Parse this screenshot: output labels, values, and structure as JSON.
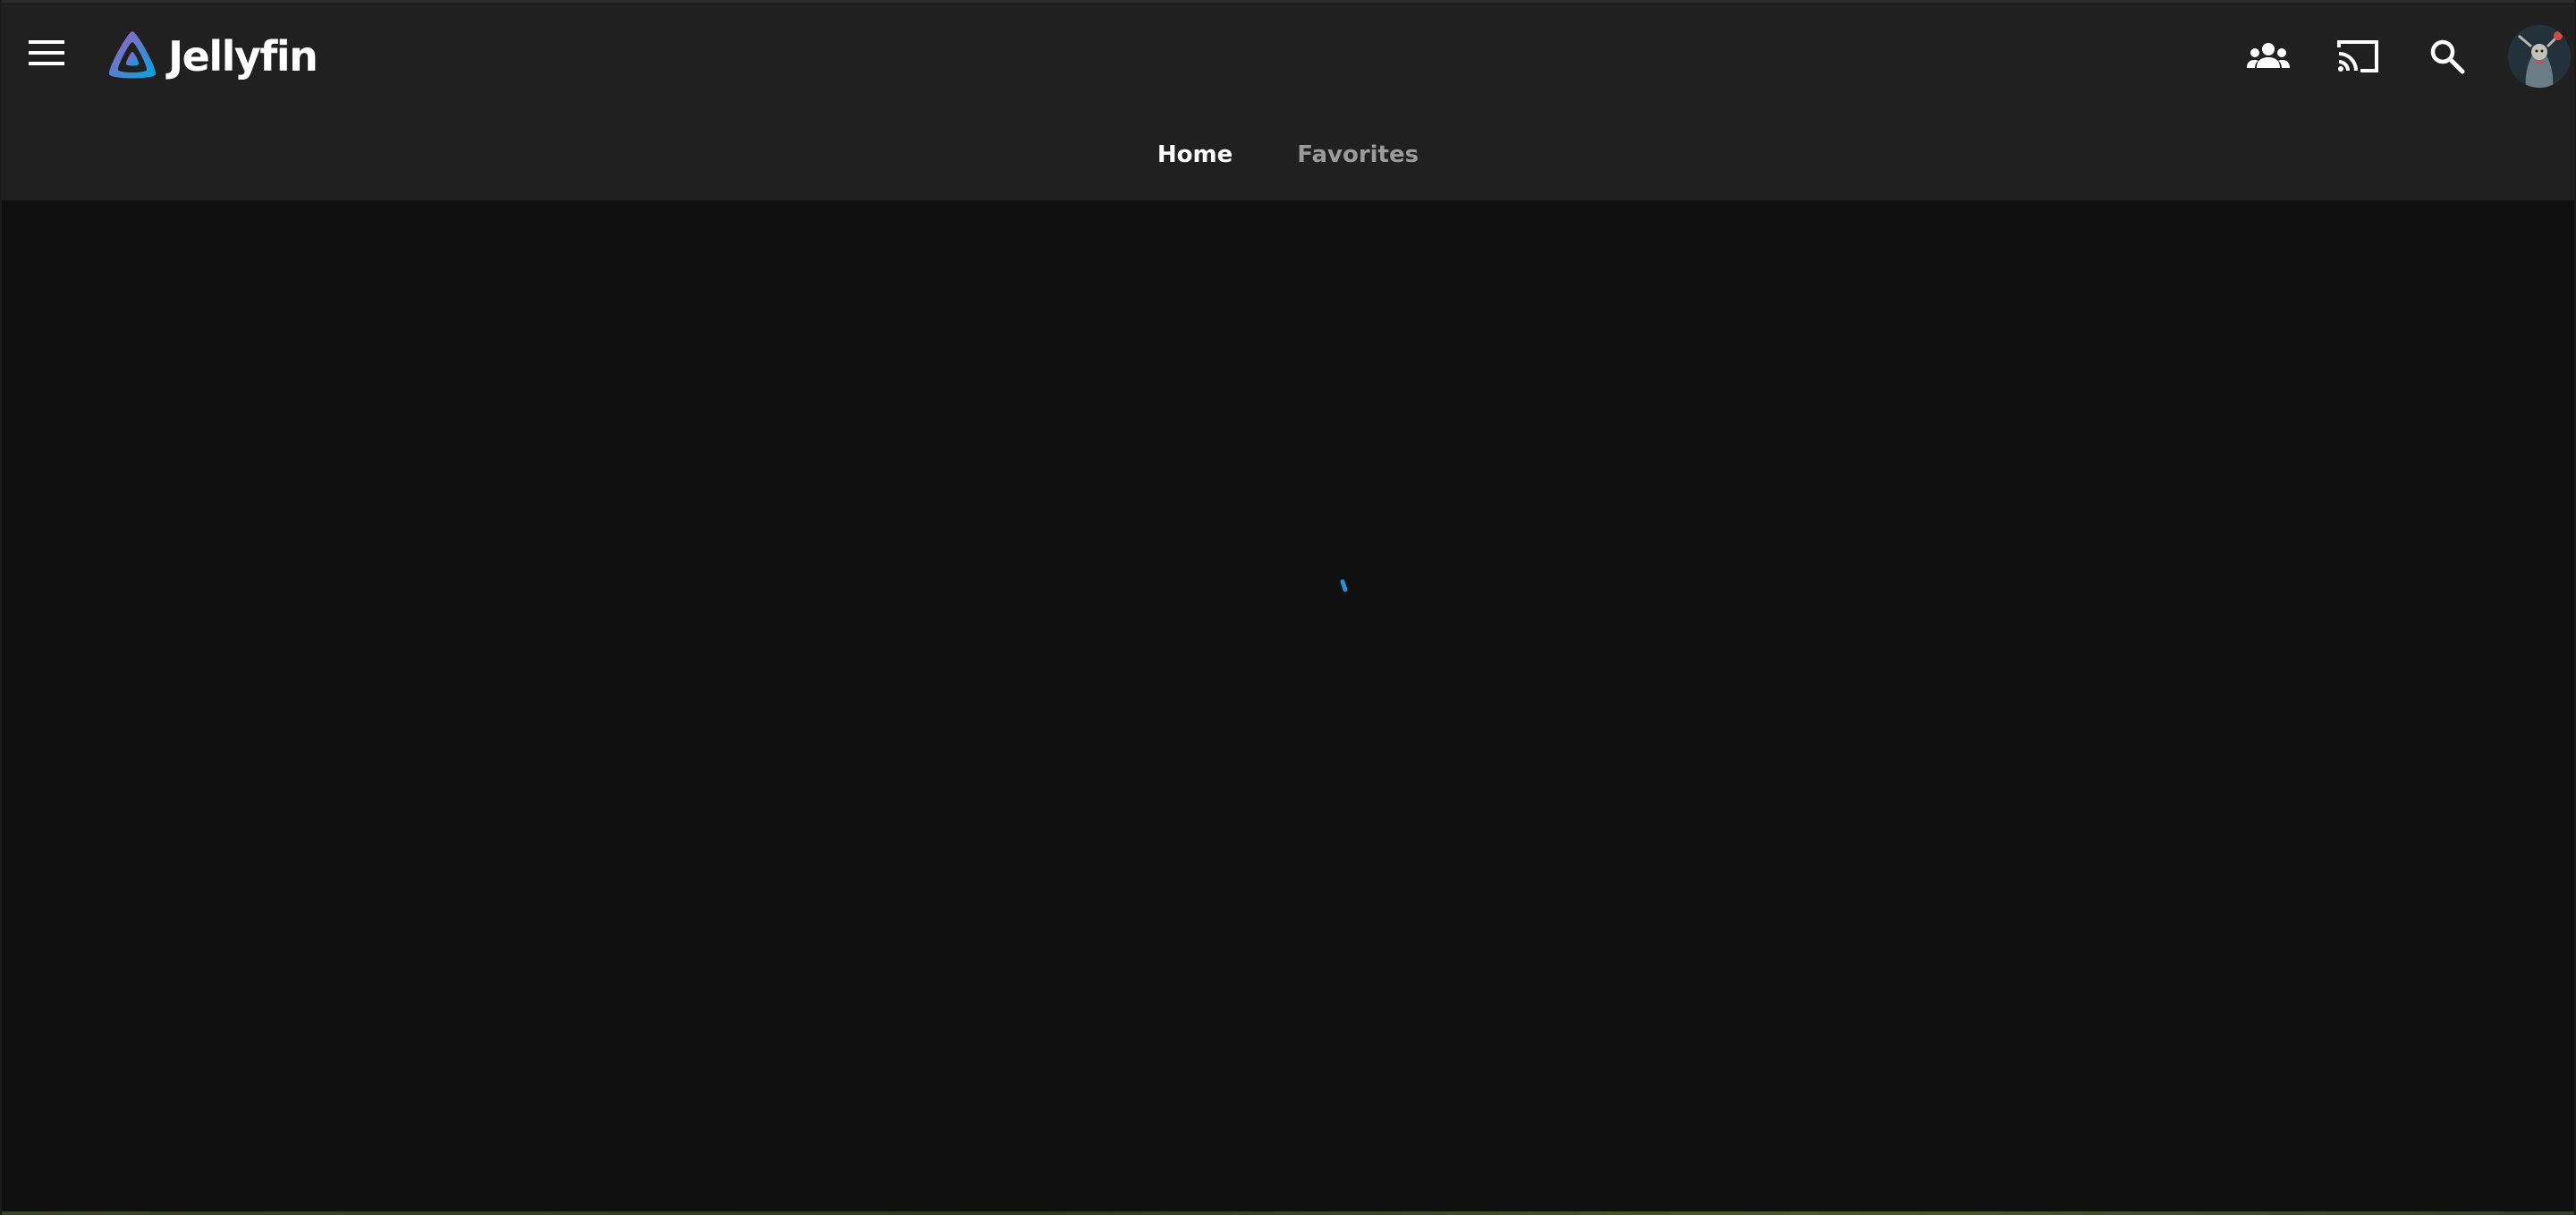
{
  "app": {
    "name": "Jellyfin"
  },
  "header": {
    "menu_icon": "hamburger-menu-icon",
    "logo_icon": "jellyfin-logo-icon",
    "actions": [
      {
        "name": "syncplay",
        "icon": "group-people-icon"
      },
      {
        "name": "cast",
        "icon": "cast-icon"
      },
      {
        "name": "search",
        "icon": "search-icon"
      }
    ],
    "avatar_icon": "user-avatar-icon"
  },
  "tabs": [
    {
      "label": "Home",
      "active": true
    },
    {
      "label": "Favorites",
      "active": false
    }
  ],
  "main": {
    "state": "loading",
    "spinner_color": "#2a8bd8"
  },
  "colors": {
    "header_bg": "#202020",
    "page_bg": "#101010",
    "accent_blue": "#2a8bd8",
    "logo_purple": "#aa5cc3",
    "logo_blue": "#00a4dc"
  }
}
